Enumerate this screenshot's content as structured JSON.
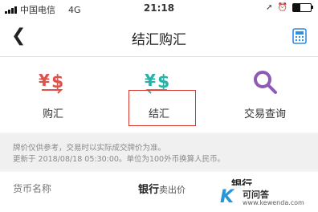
{
  "status_bar": {
    "carrier": "中国电信",
    "network": "4G",
    "time": "21:18"
  },
  "nav": {
    "title": "结汇购汇",
    "back_icon": "chevron-left-icon",
    "calculator_icon": "calculator-icon"
  },
  "actions": [
    {
      "label": "购汇",
      "symbol": "¥$",
      "color": "#e0524a"
    },
    {
      "label": "结汇",
      "symbol": "¥$",
      "color": "#27b3a9"
    },
    {
      "label": "交易查询",
      "color": "#8e5ab3"
    }
  ],
  "notice": {
    "line1": "牌价仅供参考，交易时以实际成交牌价为准。",
    "line2": "更新于 2018/08/18 05:30:00。单位为100外币换算人民币。"
  },
  "table_header": {
    "currency_name": "货币名称",
    "bank": "银行",
    "sell_price": "卖出价",
    "next_col": "银行"
  },
  "watermark": {
    "letter": "K",
    "name": "可问答",
    "url": "www.kewenda.com"
  }
}
